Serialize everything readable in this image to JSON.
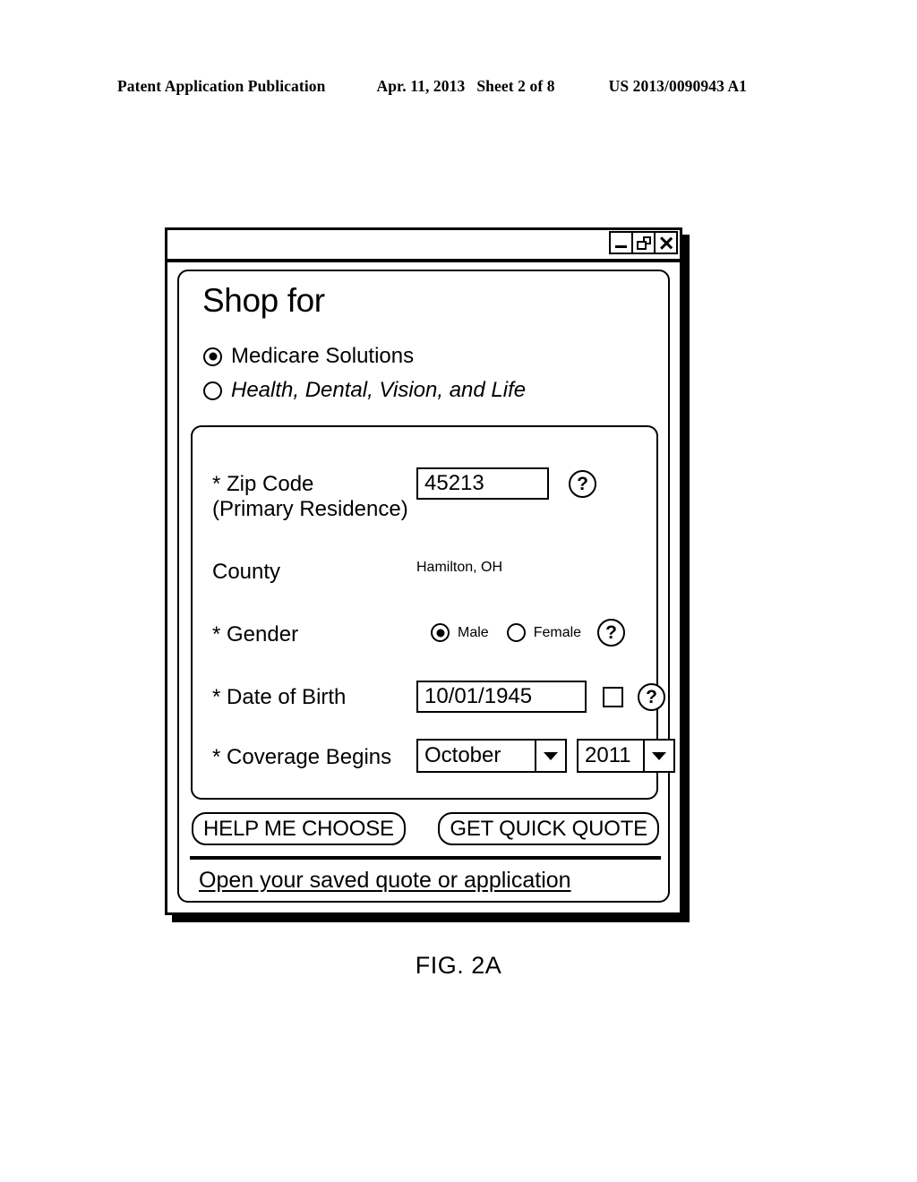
{
  "patent_header": {
    "publication": "Patent Application Publication",
    "date": "Apr. 11, 2013",
    "sheet": "Sheet 2 of 8",
    "doc_number": "US 2013/0090943 A1"
  },
  "window": {
    "title_bar": {
      "minimize_label": "Minimize",
      "restore_label": "Restore",
      "close_label": "Close"
    },
    "heading": "Shop for",
    "shop_options": [
      {
        "label": "Medicare Solutions",
        "selected": true,
        "italic": false
      },
      {
        "label": "Health, Dental, Vision, and Life",
        "selected": false,
        "italic": true
      }
    ],
    "form": {
      "zip": {
        "label": "* Zip Code\n(Primary Residence)",
        "value": "45213",
        "help": "?"
      },
      "county": {
        "label": "County",
        "value": "Hamilton, OH"
      },
      "gender": {
        "label": "* Gender",
        "options": [
          {
            "label": "Male",
            "selected": true
          },
          {
            "label": "Female",
            "selected": false
          }
        ],
        "help": "?"
      },
      "dob": {
        "label": "* Date of Birth",
        "value": "10/01/1945",
        "checkbox_checked": false,
        "help": "?"
      },
      "coverage": {
        "label": "* Coverage Begins",
        "month": "October",
        "year": "2011"
      }
    },
    "buttons": {
      "help_me_choose": "HELP ME CHOOSE",
      "get_quick_quote": "GET QUICK QUOTE"
    },
    "saved_link": "Open your saved quote or application"
  },
  "figure_caption": "FIG. 2A"
}
